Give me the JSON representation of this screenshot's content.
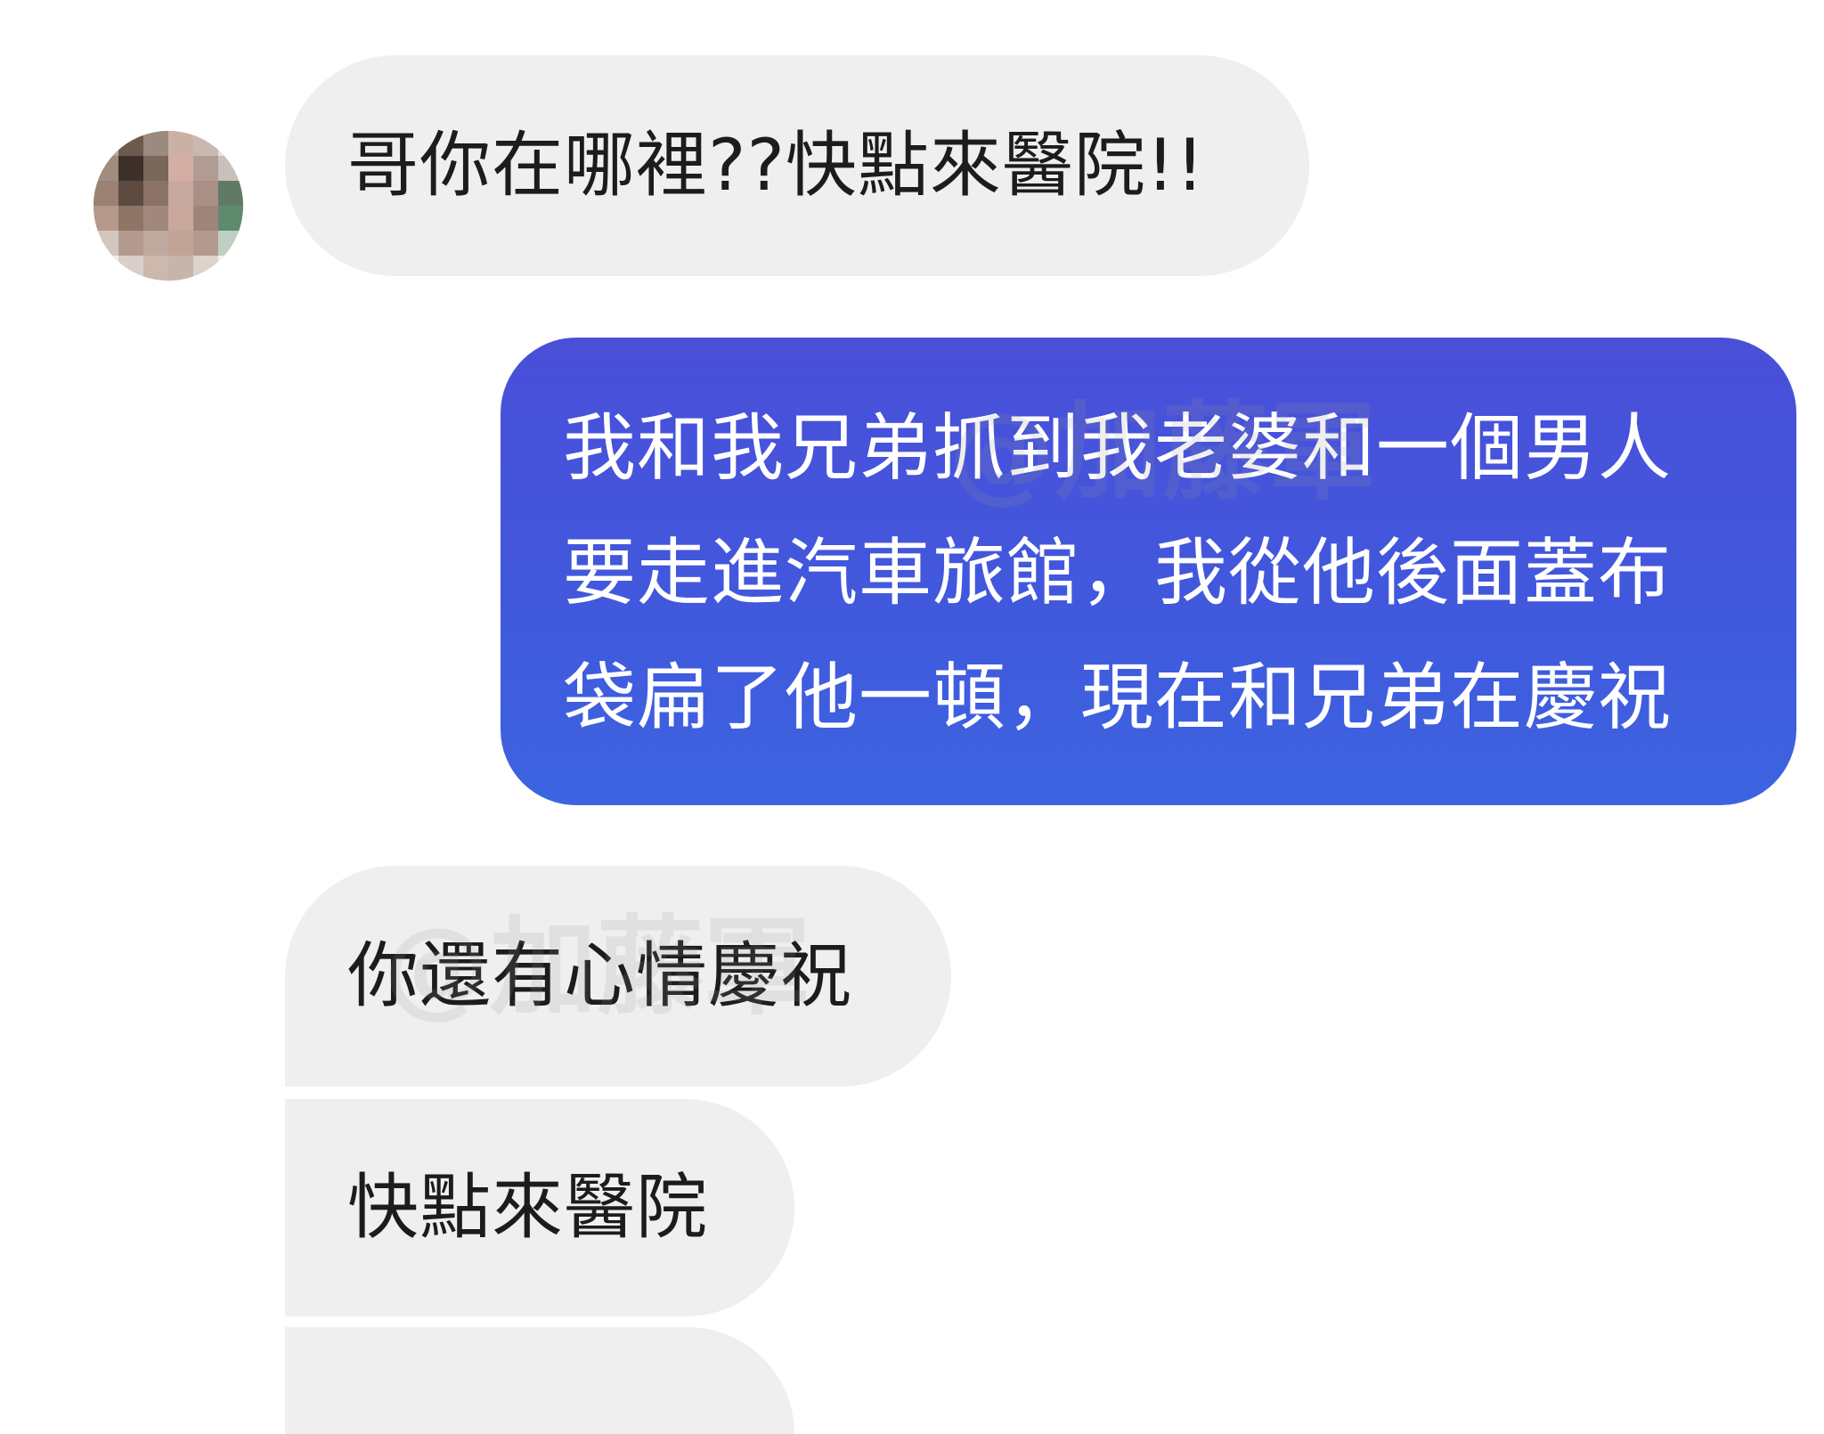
{
  "conversation": {
    "contact_avatar": {
      "pixel_colors": [
        "#b7aaa2",
        "#6d5a4f",
        "#9b8a7f",
        "#cbb0a5",
        "#c8b8af",
        "#e8e1dc",
        "#a18d80",
        "#3d2f2a",
        "#7a675c",
        "#d4aea5",
        "#b19c93",
        "#c9c0b9",
        "#9a8173",
        "#5d4b42",
        "#8a7268",
        "#c6a8a1",
        "#a98f86",
        "#607a66",
        "#b4998c",
        "#8f7565",
        "#a0897c",
        "#caa79d",
        "#9e857a",
        "#5f8a6e",
        "#d2c6bf",
        "#b49a8e",
        "#c0aa9f",
        "#c1a496",
        "#b29a8f",
        "#bdd0c3",
        "#eeeeee",
        "#d8cfc9",
        "#cdb8ad",
        "#c8b4aa",
        "#ddd3cd",
        "#f3f3f3"
      ]
    },
    "messages": [
      {
        "direction": "incoming",
        "text": "哥你在哪裡??快點來醫院!!"
      },
      {
        "direction": "outgoing",
        "lines": [
          "我和我兄弟抓到我老婆和一個男人",
          "要走進汽車旅館，我從他後面蓋布",
          "袋扁了他一頓，現在和兄弟在慶祝"
        ]
      },
      {
        "direction": "incoming",
        "text": "你還有心情慶祝"
      },
      {
        "direction": "incoming",
        "text": "快點來醫院"
      },
      {
        "direction": "incoming",
        "text": ""
      }
    ],
    "watermark": "@加藤軍",
    "colors": {
      "incoming_bubble": "#efefef",
      "outgoing_bubble": "#4158dd",
      "incoming_text": "#1c1c1c",
      "outgoing_text": "#ffffff"
    }
  }
}
